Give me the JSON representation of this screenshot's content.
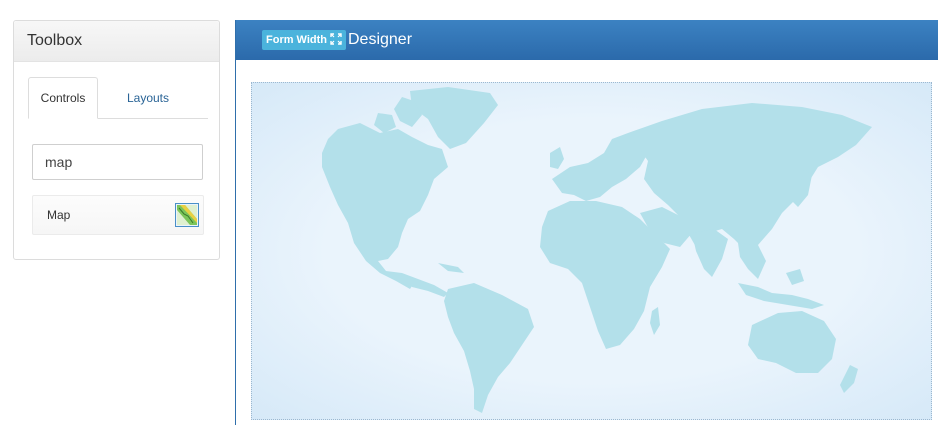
{
  "toolbox": {
    "title": "Toolbox",
    "tabs": [
      {
        "label": "Controls",
        "active": true
      },
      {
        "label": "Layouts",
        "active": false
      }
    ],
    "search_value": "map",
    "controls": [
      {
        "label": "Map",
        "icon": "map-icon"
      }
    ]
  },
  "designer": {
    "form_width_label": "Form Width",
    "form_width_icon": "expand-icon",
    "title": "Designer",
    "map_color": "#b3e0ea",
    "header_color": "#2f73b5"
  }
}
